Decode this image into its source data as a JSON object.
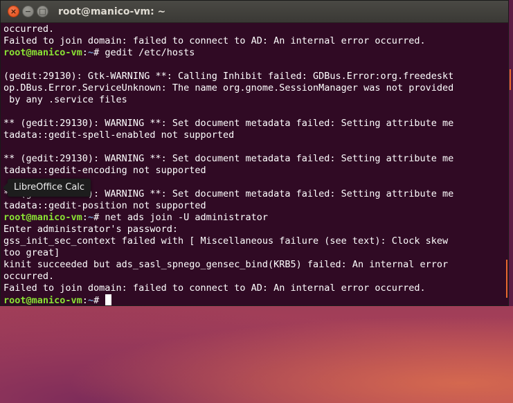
{
  "window": {
    "title": "root@manico-vm: ~",
    "close_glyph": "×",
    "minimize_glyph": "−",
    "maximize_glyph": "□"
  },
  "terminal": {
    "prompt": {
      "user": "root@manico-vm",
      "sep": ":",
      "path": "~",
      "symbol": "# "
    },
    "lines": [
      {
        "kind": "text",
        "text": "occurred."
      },
      {
        "kind": "text",
        "text": "Failed to join domain: failed to connect to AD: An internal error occurred."
      },
      {
        "kind": "prompt",
        "text": "gedit /etc/hosts"
      },
      {
        "kind": "text",
        "text": ""
      },
      {
        "kind": "text",
        "text": "(gedit:29130): Gtk-WARNING **: Calling Inhibit failed: GDBus.Error:org.freedeskt"
      },
      {
        "kind": "text",
        "text": "op.DBus.Error.ServiceUnknown: The name org.gnome.SessionManager was not provided"
      },
      {
        "kind": "text",
        "text": " by any .service files"
      },
      {
        "kind": "text",
        "text": ""
      },
      {
        "kind": "text",
        "text": "** (gedit:29130): WARNING **: Set document metadata failed: Setting attribute me"
      },
      {
        "kind": "text",
        "text": "tadata::gedit-spell-enabled not supported"
      },
      {
        "kind": "text",
        "text": ""
      },
      {
        "kind": "text",
        "text": "** (gedit:29130): WARNING **: Set document metadata failed: Setting attribute me"
      },
      {
        "kind": "text",
        "text": "tadata::gedit-encoding not supported"
      },
      {
        "kind": "text",
        "text": ""
      },
      {
        "kind": "text",
        "text": "** (gedit:29130): WARNING **: Set document metadata failed: Setting attribute me"
      },
      {
        "kind": "text",
        "text": "tadata::gedit-position not supported"
      },
      {
        "kind": "prompt",
        "text": "net ads join -U administrator"
      },
      {
        "kind": "text",
        "text": "Enter administrator's password:"
      },
      {
        "kind": "text",
        "text": "gss_init_sec_context failed with [ Miscellaneous failure (see text): Clock skew"
      },
      {
        "kind": "text",
        "text": "too great]"
      },
      {
        "kind": "text",
        "text": "kinit succeeded but ads_sasl_spnego_gensec_bind(KRB5) failed: An internal error"
      },
      {
        "kind": "text",
        "text": "occurred."
      },
      {
        "kind": "text",
        "text": "Failed to join domain: failed to connect to AD: An internal error occurred."
      },
      {
        "kind": "prompt",
        "text": "",
        "cursor": true
      }
    ]
  },
  "tooltip": {
    "label": "LibreOffice Calc"
  },
  "colors": {
    "terminal_bg": "#300a24",
    "prompt_user": "#8ae234",
    "prompt_path": "#729fcf",
    "text": "#ffffff"
  }
}
